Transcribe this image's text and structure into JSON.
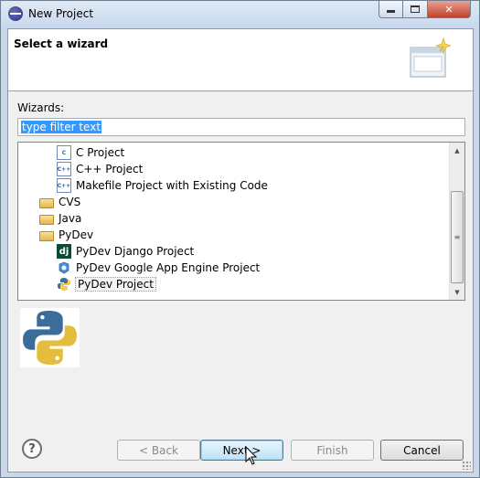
{
  "window": {
    "title": "New Project"
  },
  "banner": {
    "title": "Select a wizard"
  },
  "filter": {
    "label": "Wizards:",
    "value": "type filter text"
  },
  "tree": {
    "items": [
      {
        "label": "C Project",
        "icon": "c-project-icon",
        "indent": 2
      },
      {
        "label": "C++ Project",
        "icon": "cpp-project-icon",
        "indent": 2
      },
      {
        "label": "Makefile Project with Existing Code",
        "icon": "makefile-project-icon",
        "indent": 2
      },
      {
        "label": "CVS",
        "icon": "folder-icon",
        "indent": 1
      },
      {
        "label": "Java",
        "icon": "folder-icon",
        "indent": 1
      },
      {
        "label": "PyDev",
        "icon": "folder-icon",
        "indent": 1
      },
      {
        "label": "PyDev Django Project",
        "icon": "django-icon",
        "indent": 2
      },
      {
        "label": "PyDev Google App Engine Project",
        "icon": "gae-icon",
        "indent": 2
      },
      {
        "label": "PyDev Project",
        "icon": "python-icon",
        "indent": 2,
        "selected": true
      }
    ],
    "file_icon_text": {
      "c": "C",
      "cpp": "C++",
      "make": "C++"
    },
    "django_icon_text": "dj"
  },
  "buttons": {
    "back": "< Back",
    "next": "Next >",
    "finish": "Finish",
    "cancel": "Cancel",
    "help_glyph": "?"
  },
  "colors": {
    "selection": "#3399ff",
    "default_button": "#bfe1f6"
  }
}
